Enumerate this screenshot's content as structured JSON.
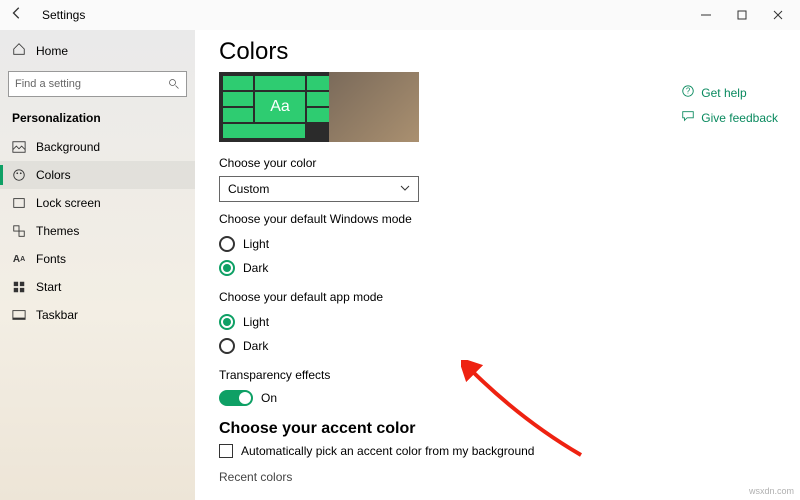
{
  "titlebar": {
    "title": "Settings"
  },
  "sidebar": {
    "home": "Home",
    "search_placeholder": "Find a setting",
    "section": "Personalization",
    "items": [
      {
        "label": "Background"
      },
      {
        "label": "Colors"
      },
      {
        "label": "Lock screen"
      },
      {
        "label": "Themes"
      },
      {
        "label": "Fonts"
      },
      {
        "label": "Start"
      },
      {
        "label": "Taskbar"
      }
    ]
  },
  "main": {
    "heading": "Colors",
    "preview_text": "Aa",
    "choose_color_label": "Choose your color",
    "color_select_value": "Custom",
    "windows_mode_label": "Choose your default Windows mode",
    "windows_mode": {
      "light": "Light",
      "dark": "Dark"
    },
    "app_mode_label": "Choose your default app mode",
    "app_mode": {
      "light": "Light",
      "dark": "Dark"
    },
    "transparency_label": "Transparency effects",
    "transparency_value": "On",
    "accent_heading": "Choose your accent color",
    "accent_auto_label": "Automatically pick an accent color from my background",
    "recent_label": "Recent colors"
  },
  "right": {
    "help": "Get help",
    "feedback": "Give feedback"
  },
  "watermark": "wsxdn.com"
}
